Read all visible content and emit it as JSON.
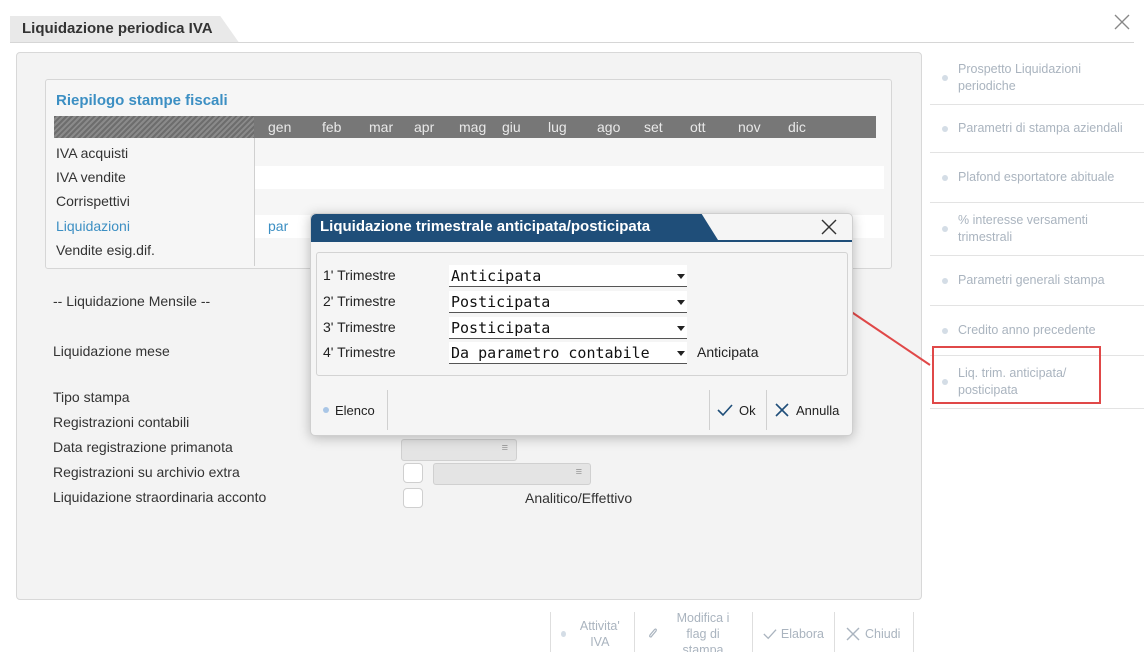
{
  "window": {
    "title": "Liquidazione periodica IVA",
    "close_icon": "close-icon"
  },
  "riepilogo": {
    "title": "Riepilogo stampe fiscali",
    "months": [
      "gen",
      "feb",
      "mar",
      "apr",
      "mag",
      "giu",
      "lug",
      "ago",
      "set",
      "ott",
      "nov",
      "dic"
    ],
    "rows": [
      {
        "label": "IVA acquisti"
      },
      {
        "label": "IVA vendite"
      },
      {
        "label": "Corrispettivi"
      },
      {
        "label": "Liquidazioni",
        "first_value": "par"
      },
      {
        "label": "Vendite esig.dif."
      }
    ]
  },
  "form": {
    "mensile_label": "-- Liquidazione Mensile --",
    "mese_label": "Liquidazione mese",
    "tipo_stampa_label": "Tipo stampa",
    "registrazioni_label": "Registrazioni contabili",
    "data_reg_label": "Data registrazione primanota",
    "archivio_extra_label": "Registrazioni su archivio extra",
    "straordinaria_label": "Liquidazione straordinaria acconto",
    "analitico_text": "Analitico/Effettivo"
  },
  "sidebar": {
    "items": [
      {
        "label": "Prospetto Liquidazioni periodiche"
      },
      {
        "label": "Parametri di stampa aziendali"
      },
      {
        "label": "Plafond esportatore abituale"
      },
      {
        "label": "% interesse versamenti trimestrali"
      },
      {
        "label": "Parametri generali stampa"
      },
      {
        "label": "Credito anno precedente"
      },
      {
        "label": "Liq. trim. anticipata/ posticipata"
      }
    ]
  },
  "bottom_bar": {
    "attivita_label": "Attivita' IVA",
    "modifica_label": "Modifica i flag di stampa",
    "elabora_label": "Elabora",
    "chiudi_label": "Chiudi"
  },
  "dialog": {
    "title": "Liquidazione trimestrale anticipata/posticipata",
    "rows": [
      {
        "label": "1' Trimestre",
        "value": "Anticipata"
      },
      {
        "label": "2' Trimestre",
        "value": "Posticipata"
      },
      {
        "label": "3' Trimestre",
        "value": "Posticipata"
      },
      {
        "label": "4' Trimestre",
        "value": "Da parametro contabile"
      }
    ],
    "row4_extra": "Anticipata",
    "elenco_label": "Elenco",
    "ok_label": "Ok",
    "annulla_label": "Annulla"
  },
  "colors": {
    "dialog_title_bg": "#1f4e79",
    "link_blue": "#3c8fc3",
    "highlight_red": "#e04848"
  }
}
